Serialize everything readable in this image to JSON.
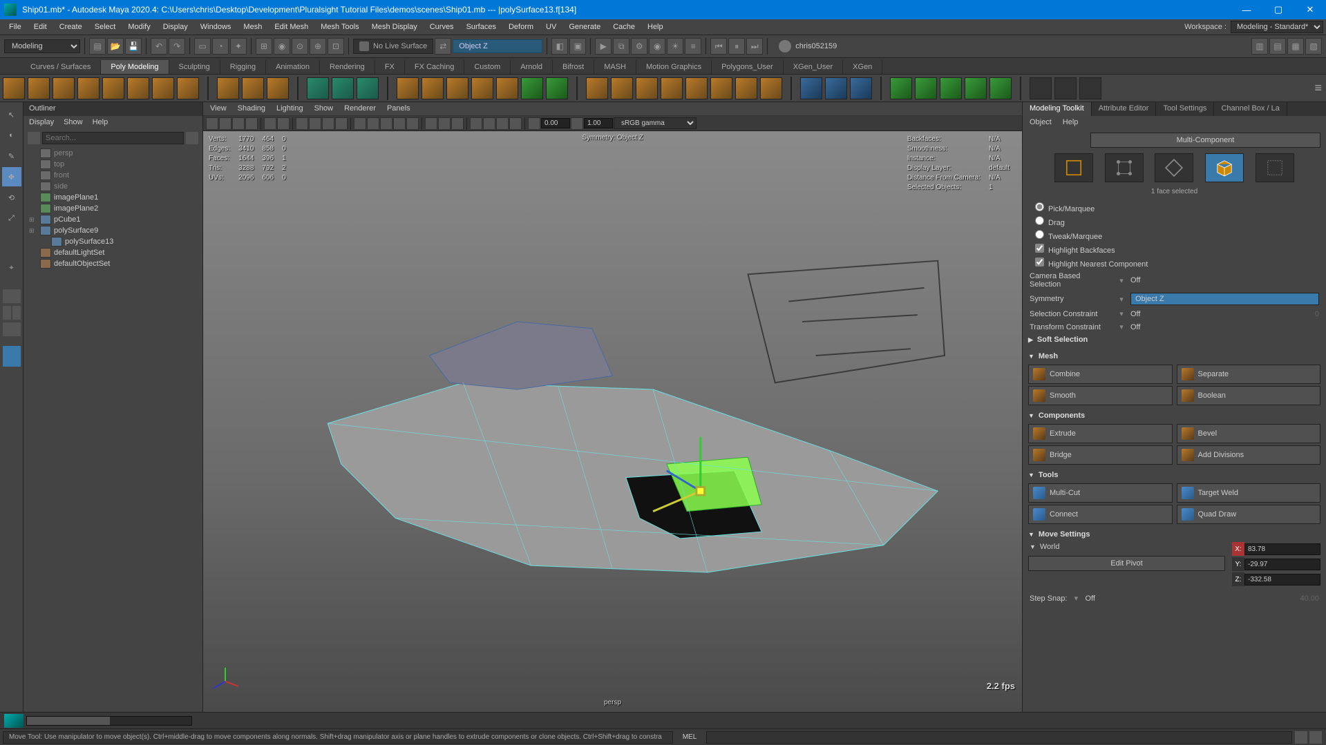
{
  "title": "Ship01.mb* - Autodesk Maya 2020.4: C:\\Users\\chris\\Desktop\\Development\\Pluralsight Tutorial Files\\demos\\scenes\\Ship01.mb  ---  |polySurface13.f[134]",
  "workspace_label": "Workspace :",
  "workspace_value": "Modeling - Standard*",
  "menu": [
    "File",
    "Edit",
    "Create",
    "Select",
    "Modify",
    "Display",
    "Windows",
    "Mesh",
    "Edit Mesh",
    "Mesh Tools",
    "Mesh Display",
    "Curves",
    "Surfaces",
    "Deform",
    "UV",
    "Generate",
    "Cache",
    "Help"
  ],
  "mode_selector": "Modeling",
  "no_live": "No Live Surface",
  "sym_value": "Object Z",
  "account": "chris052159",
  "shelf_tabs": [
    "Curves / Surfaces",
    "Poly Modeling",
    "Sculpting",
    "Rigging",
    "Animation",
    "Rendering",
    "FX",
    "FX Caching",
    "Custom",
    "Arnold",
    "Bifrost",
    "MASH",
    "Motion Graphics",
    "Polygons_User",
    "XGen_User",
    "XGen"
  ],
  "shelf_active": 1,
  "outliner": {
    "title": "Outliner",
    "menus": [
      "Display",
      "Show",
      "Help"
    ],
    "search_placeholder": "Search...",
    "items": [
      {
        "name": "persp",
        "dim": true,
        "icon": "cam"
      },
      {
        "name": "top",
        "dim": true,
        "icon": "cam"
      },
      {
        "name": "front",
        "dim": true,
        "icon": "cam"
      },
      {
        "name": "side",
        "dim": true,
        "icon": "cam"
      },
      {
        "name": "imagePlane1",
        "icon": "shape"
      },
      {
        "name": "imagePlane2",
        "icon": "shape"
      },
      {
        "name": "pCube1",
        "icon": "xform",
        "expand": true
      },
      {
        "name": "polySurface9",
        "icon": "xform",
        "expand": true
      },
      {
        "name": "polySurface13",
        "icon": "xform",
        "indent": 1
      },
      {
        "name": "defaultLightSet",
        "icon": "set"
      },
      {
        "name": "defaultObjectSet",
        "icon": "set"
      }
    ]
  },
  "viewport_menus": [
    "View",
    "Shading",
    "Lighting",
    "Show",
    "Renderer",
    "Panels"
  ],
  "viewport_fields": {
    "near": "0.00",
    "far": "1.00",
    "gamma": "sRGB gamma"
  },
  "hud": {
    "stats": [
      [
        "Verts:",
        "1770",
        "464",
        "0"
      ],
      [
        "Edges:",
        "3410",
        "858",
        "0"
      ],
      [
        "Faces:",
        "1644",
        "396",
        "1"
      ],
      [
        "Tris:",
        "3288",
        "792",
        "2"
      ],
      [
        "UVs:",
        "2096",
        "606",
        "0"
      ]
    ],
    "symmetry": "Symmetry: Object Z",
    "right": [
      [
        "Backfaces:",
        "N/A"
      ],
      [
        "Smoothness:",
        "N/A"
      ],
      [
        "Instance:",
        "N/A"
      ],
      [
        "Display Layer:",
        "default"
      ],
      [
        "Distance From Camera:",
        "N/A"
      ],
      [
        "Selected Objects:",
        "1"
      ]
    ],
    "fps": "2.2 fps",
    "camname": "persp"
  },
  "toolkit": {
    "tabs": [
      "Modeling Toolkit",
      "Attribute Editor",
      "Tool Settings",
      "Channel Box / La"
    ],
    "submenus": [
      "Object",
      "Help"
    ],
    "multi": "Multi-Component",
    "sel_status": "1 face selected",
    "radios": [
      "Pick/Marquee",
      "Drag",
      "Tweak/Marquee"
    ],
    "checks": [
      "Highlight Backfaces",
      "Highlight Nearest Component"
    ],
    "opts": {
      "camera_sel": {
        "label": "Camera Based Selection",
        "val": "Off"
      },
      "symmetry": {
        "label": "Symmetry",
        "val": "Object Z"
      },
      "sel_con": {
        "label": "Selection Constraint",
        "val": "Off",
        "extra": "0"
      },
      "xform_con": {
        "label": "Transform Constraint",
        "val": "Off"
      }
    },
    "soft_sel": "Soft Selection",
    "mesh_label": "Mesh",
    "mesh_btns": [
      [
        "Combine",
        "Separate"
      ],
      [
        "Smooth",
        "Boolean"
      ]
    ],
    "comp_label": "Components",
    "comp_btns": [
      [
        "Extrude",
        "Bevel"
      ],
      [
        "Bridge",
        "Add Divisions"
      ]
    ],
    "tools_label": "Tools",
    "tools_btns": [
      [
        "Multi-Cut",
        "Target Weld"
      ],
      [
        "Connect",
        "Quad Draw"
      ]
    ],
    "move_label": "Move Settings",
    "world": "World",
    "coords": {
      "x": "83.78",
      "y": "-29.97",
      "z": "-332.58"
    },
    "edit_pivot": "Edit Pivot",
    "step_snap": {
      "label": "Step Snap:",
      "val": "Off",
      "num": "40.00"
    }
  },
  "status_hint": "Move Tool: Use manipulator to move object(s). Ctrl+middle-drag to move components along normals. Shift+drag manipulator axis or plane handles to extrude components or clone objects. Ctrl+Shift+drag to constra",
  "mel": "MEL"
}
